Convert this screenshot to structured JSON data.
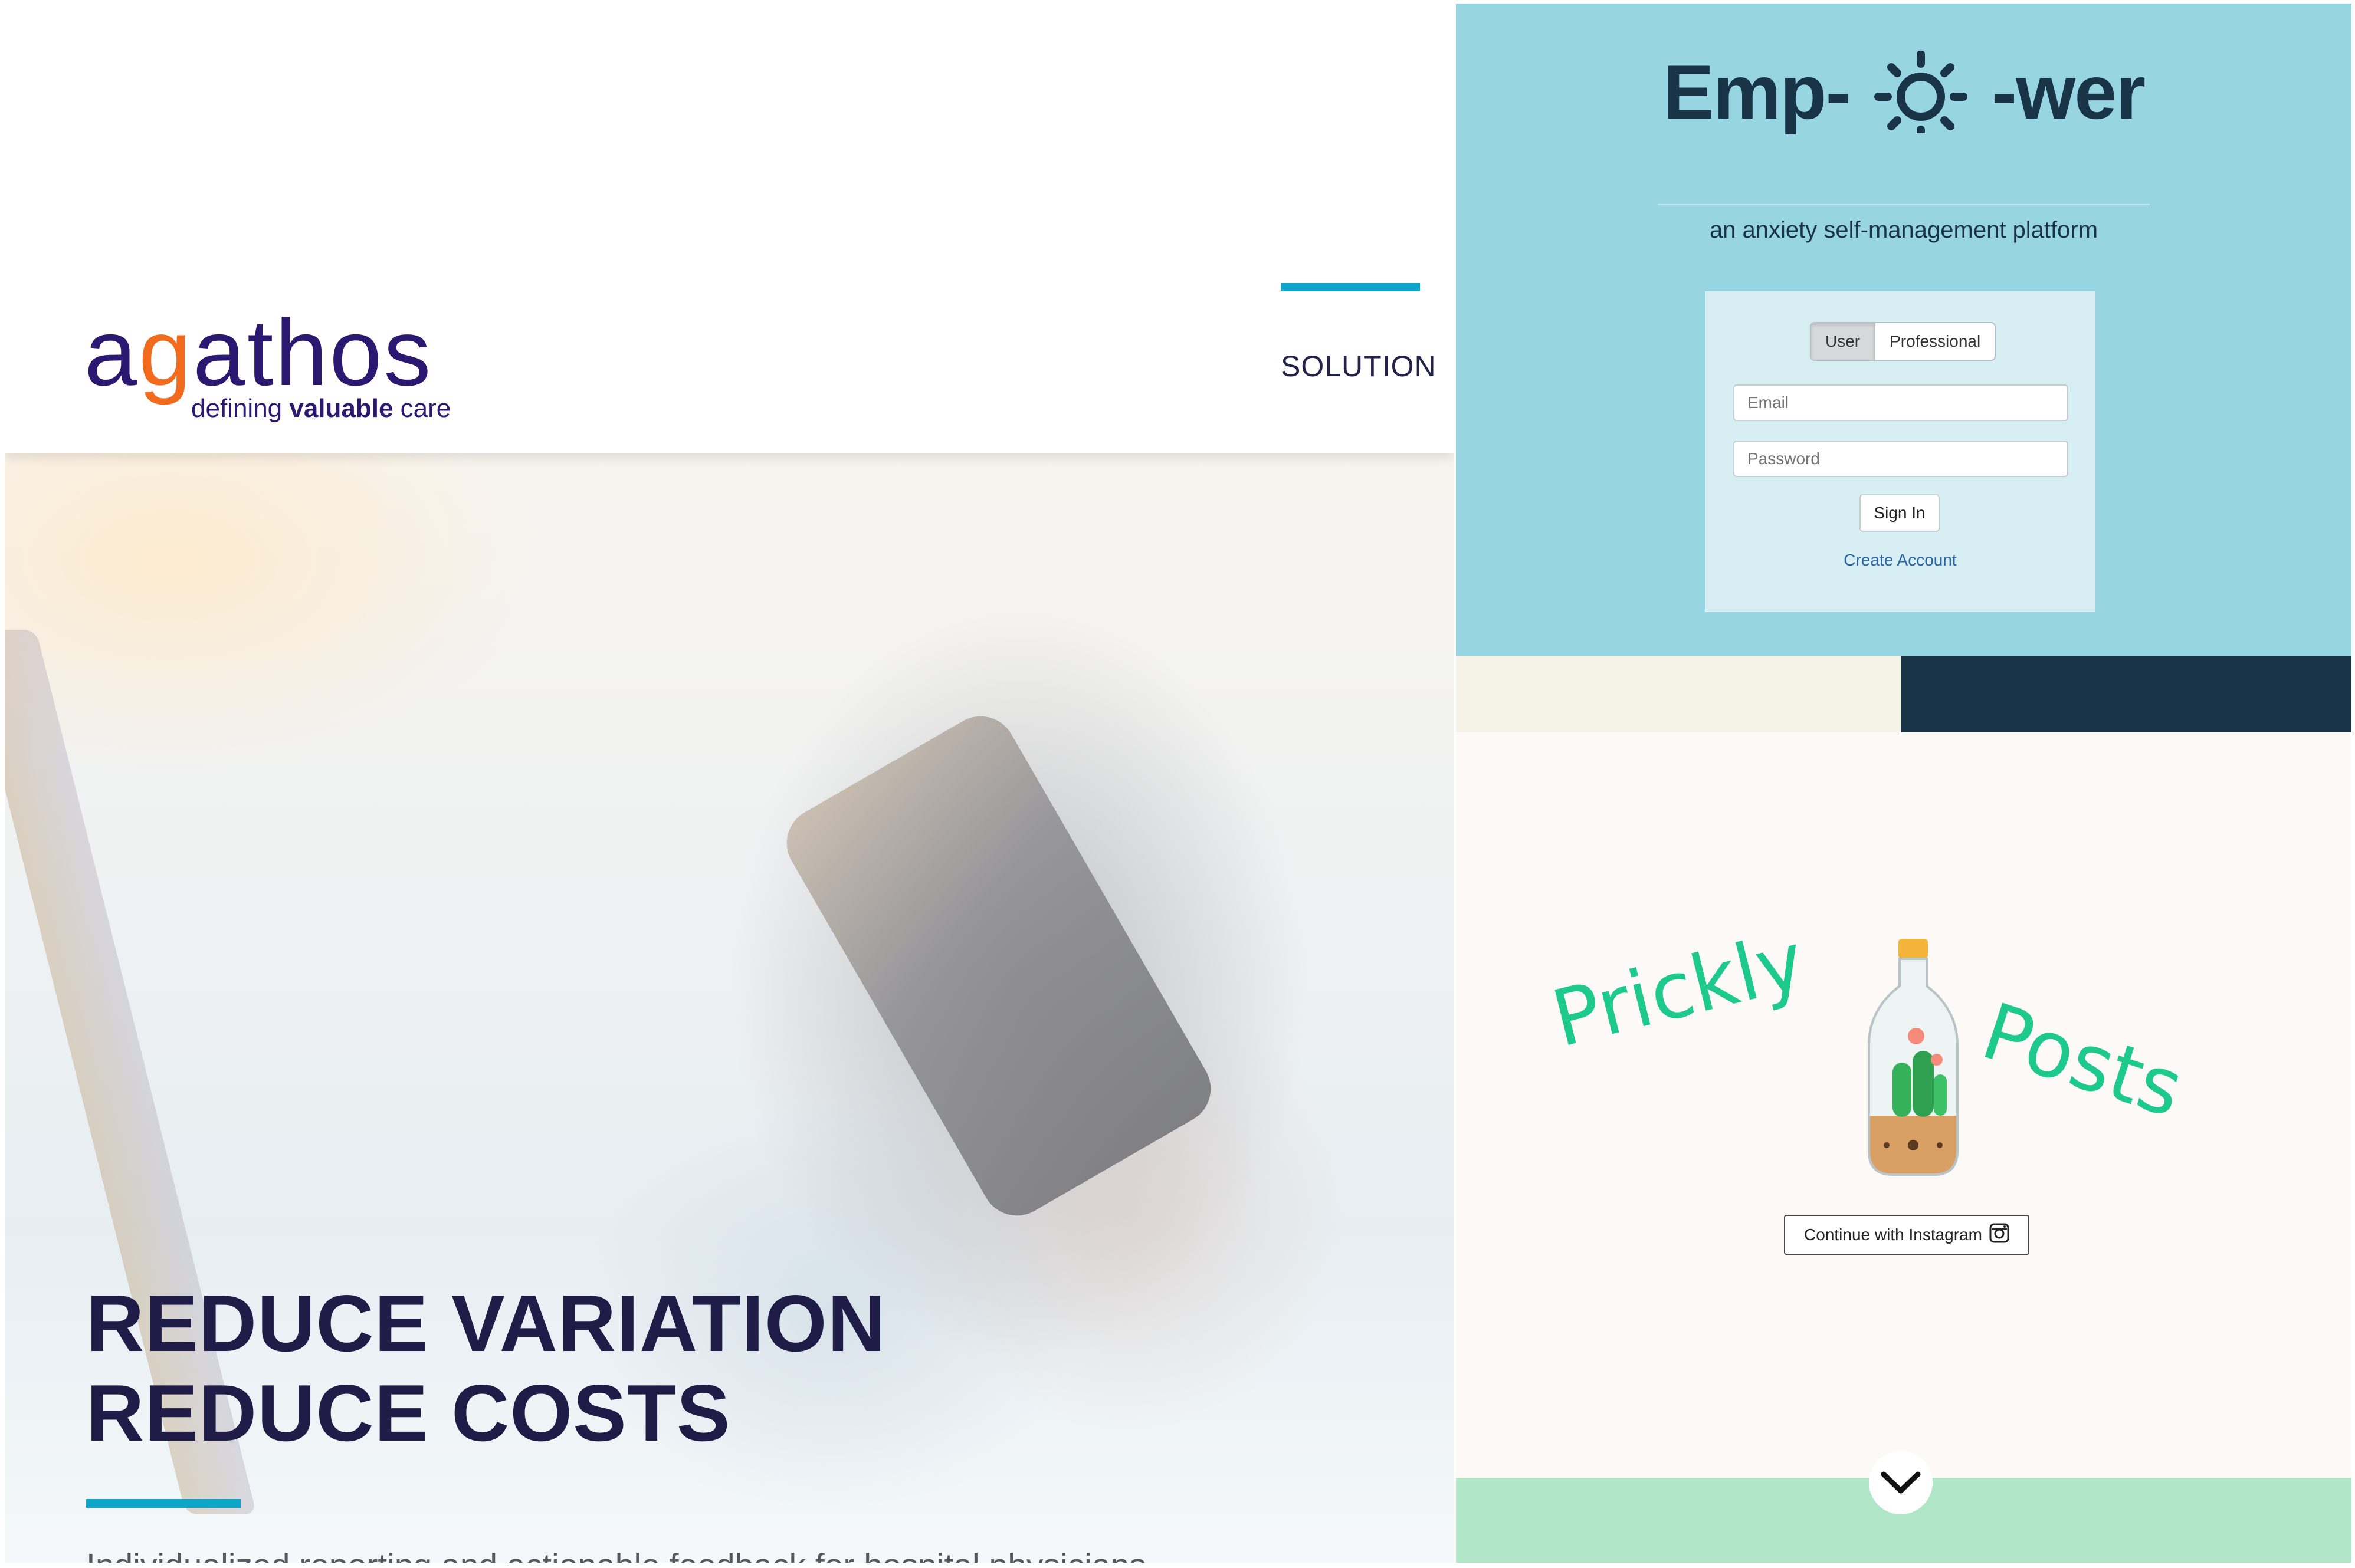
{
  "agathos": {
    "logo_text_a": "a",
    "logo_text_g": "g",
    "logo_text_rest": "athos",
    "tagline_pre": "defining ",
    "tagline_bold": "valuable",
    "tagline_post": " care",
    "nav_solution": "SOLUTION",
    "headline_line1": "REDUCE VARIATION",
    "headline_line2": "REDUCE COSTS",
    "subtitle": "Individualized reporting and actionable feedback for hospital physicians",
    "colors": {
      "brand": "#2b1870",
      "accent_orange": "#f26a1b",
      "accent_cyan": "#0ea6c8"
    }
  },
  "empower": {
    "logo_left": "Emp-",
    "logo_right": "-wer",
    "logo_icon": "sun-icon",
    "tagline": "an anxiety self-management platform",
    "toggle": [
      "User",
      "Professional"
    ],
    "toggle_selected": "User",
    "email_placeholder": "Email",
    "password_placeholder": "Password",
    "signin_label": "Sign In",
    "create_account_label": "Create Account",
    "colors": {
      "background": "#98d5e2",
      "text": "#1a3447",
      "link": "#2b65a8"
    }
  },
  "prickly": {
    "word1": "Prickly",
    "word2": "Posts",
    "instagram_button_label": "Continue with Instagram",
    "instagram_icon": "instagram-icon",
    "bottle_icon": "cactus-bottle-icon",
    "scroll_icon": "chevron-down-icon",
    "colors": {
      "title": "#1ec98e",
      "bottom_band": "#b0e5c8"
    }
  }
}
